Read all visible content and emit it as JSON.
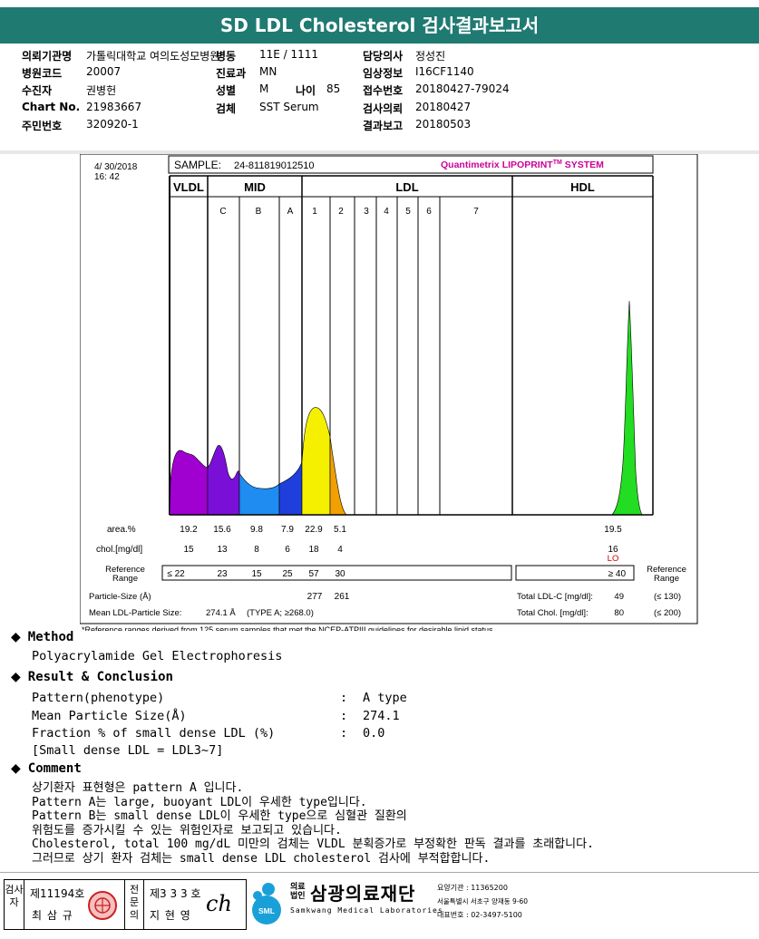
{
  "header": {
    "title": "SD LDL Cholesterol 검사결과보고서"
  },
  "info": {
    "rows": [
      [
        {
          "label": "의뢰기관명",
          "value": "가톨릭대학교 여의도성모병원"
        },
        {
          "label": "병동",
          "value": "11E / 1111"
        },
        {
          "label": "담당의사",
          "value": "정성진"
        }
      ],
      [
        {
          "label": "병원코드",
          "value": "20007"
        },
        {
          "label": "진료과",
          "value": "MN"
        },
        {
          "label": "임상정보",
          "value": "I16CF1140"
        }
      ],
      [
        {
          "label": "수진자",
          "value": "권병헌"
        },
        {
          "label": "성별",
          "value": "M"
        },
        {
          "label": "접수번호",
          "value": "20180427-79024"
        }
      ],
      [
        {
          "label": "Chart No.",
          "value": "21983667"
        },
        {
          "label": "검체",
          "value": "SST Serum"
        },
        {
          "label": "검사의뢰",
          "value": "20180427"
        }
      ],
      [
        {
          "label": "주민번호",
          "value": "320920-1"
        },
        null,
        {
          "label": "결과보고",
          "value": "20180503"
        }
      ]
    ],
    "age_label": "나이",
    "age_value": "85"
  },
  "panel": {
    "date": "4/ 30/2018",
    "time": "16: 42",
    "sample_label": "SAMPLE:",
    "sample_id": "24-811819012510",
    "brand_prefix": "Quantimetrix ",
    "brand_name": "LIPOPRINT",
    "brand_tm": "TM",
    "brand_suffix": " SYSTEM",
    "group_vldl": "VLDL",
    "group_mid": "MID",
    "group_ldl": "LDL",
    "group_hdl": "HDL",
    "band_labels": [
      "C",
      "B",
      "A",
      "1",
      "2",
      "3",
      "4",
      "5",
      "6",
      "7"
    ],
    "row_area_label": "area.%",
    "area_values": [
      "19.2",
      "15.6",
      "9.8",
      "7.9",
      "22.9",
      "5.1"
    ],
    "hdl_area": "19.5",
    "row_chol_label": "chol.[mg/dl]",
    "chol_values": [
      "15",
      "13",
      "8",
      "6",
      "18",
      "4"
    ],
    "hdl_chol": "16",
    "hdl_flag": "LO",
    "ref_label_1": "Reference",
    "ref_label_2": "Range",
    "ref_values": [
      "≤  22",
      "23",
      "15",
      "25",
      "57",
      "30"
    ],
    "hdl_ref": "≥ 40",
    "particle_label": "Particle-Size (Å)",
    "particle_values": [
      "277",
      "261"
    ],
    "mean_label": "Mean LDL-Particle Size:",
    "mean_value": "274.1 Å",
    "mean_type": "(TYPE A; ≥268.0)",
    "total_ldl_label": "Total LDL-C [mg/dl]:",
    "total_ldl_value": "49",
    "total_ldl_ref": "(≤ 130)",
    "total_chol_label": "Total Chol. [mg/dl]:",
    "total_chol_value": "80",
    "total_chol_ref": "(≤ 200)",
    "footnote": "*Reference ranges derived from 125 serum samples that met the NCEP-ATPIII guidelines for desirable lipid status."
  },
  "method": {
    "title": "Method",
    "text": "Polyacrylamide Gel Electrophoresis"
  },
  "result": {
    "title": "Result & Conclusion",
    "rows": [
      {
        "label": "Pattern(phenotype)",
        "sep": ":",
        "value": "A type"
      },
      {
        "label": "Mean Particle Size(Å)",
        "sep": ":",
        "value": "274.1"
      },
      {
        "label": "Fraction % of small dense LDL (%)",
        "sep": ":",
        "value": "0.0"
      }
    ],
    "note": "[Small dense LDL = LDL3~7]"
  },
  "comment": {
    "title": "Comment",
    "lines": [
      "상기환자 표현형은 pattern A 입니다.",
      "Pattern A는 large, buoyant LDL이 우세한 type입니다.",
      "Pattern B는 small dense LDL이 우세한 type으로 심혈관 질환의",
      "위험도를 증가시킬 수 있는 위험인자로 보고되고 있습니다.",
      "Cholesterol, total 100 mg/dL 미만의 검체는 VLDL 분획증가로 부정확한 판독 결과를 초래합니다.",
      "그러므로 상기 환자 검체는 small dense LDL cholesterol 검사에 부적합합니다."
    ]
  },
  "signature": {
    "tester_label": "검사자",
    "tester_license": "제11194호",
    "tester_name": "최 삼 규",
    "specialist_label": "전문의",
    "specialist_license": "제3 3 3 호",
    "specialist_name": "지 현 영",
    "specialist_sign": "ch"
  },
  "org": {
    "legal_1": "의료",
    "legal_2": "법인",
    "name": "삼광의료재단",
    "name_en": "Samkwang Medical Laboratories",
    "logo_text": "SML",
    "code_line": "요양기관 : 11365200",
    "address": "서울특별시 서초구 양재동 9-60",
    "phone": "대표번호 : 02-3497-5100"
  },
  "colors": {
    "header_bg": "#1f7a72",
    "brand": "#cc0099",
    "vldl": "#a000d0",
    "mid_c": "#7a10d8",
    "mid_b": "#1e8cf0",
    "mid_a": "#1f3fdc",
    "ldl1": "#f4f000",
    "ldl2": "#f0a000",
    "hdl": "#22dd22",
    "flag": "#cc0000"
  }
}
